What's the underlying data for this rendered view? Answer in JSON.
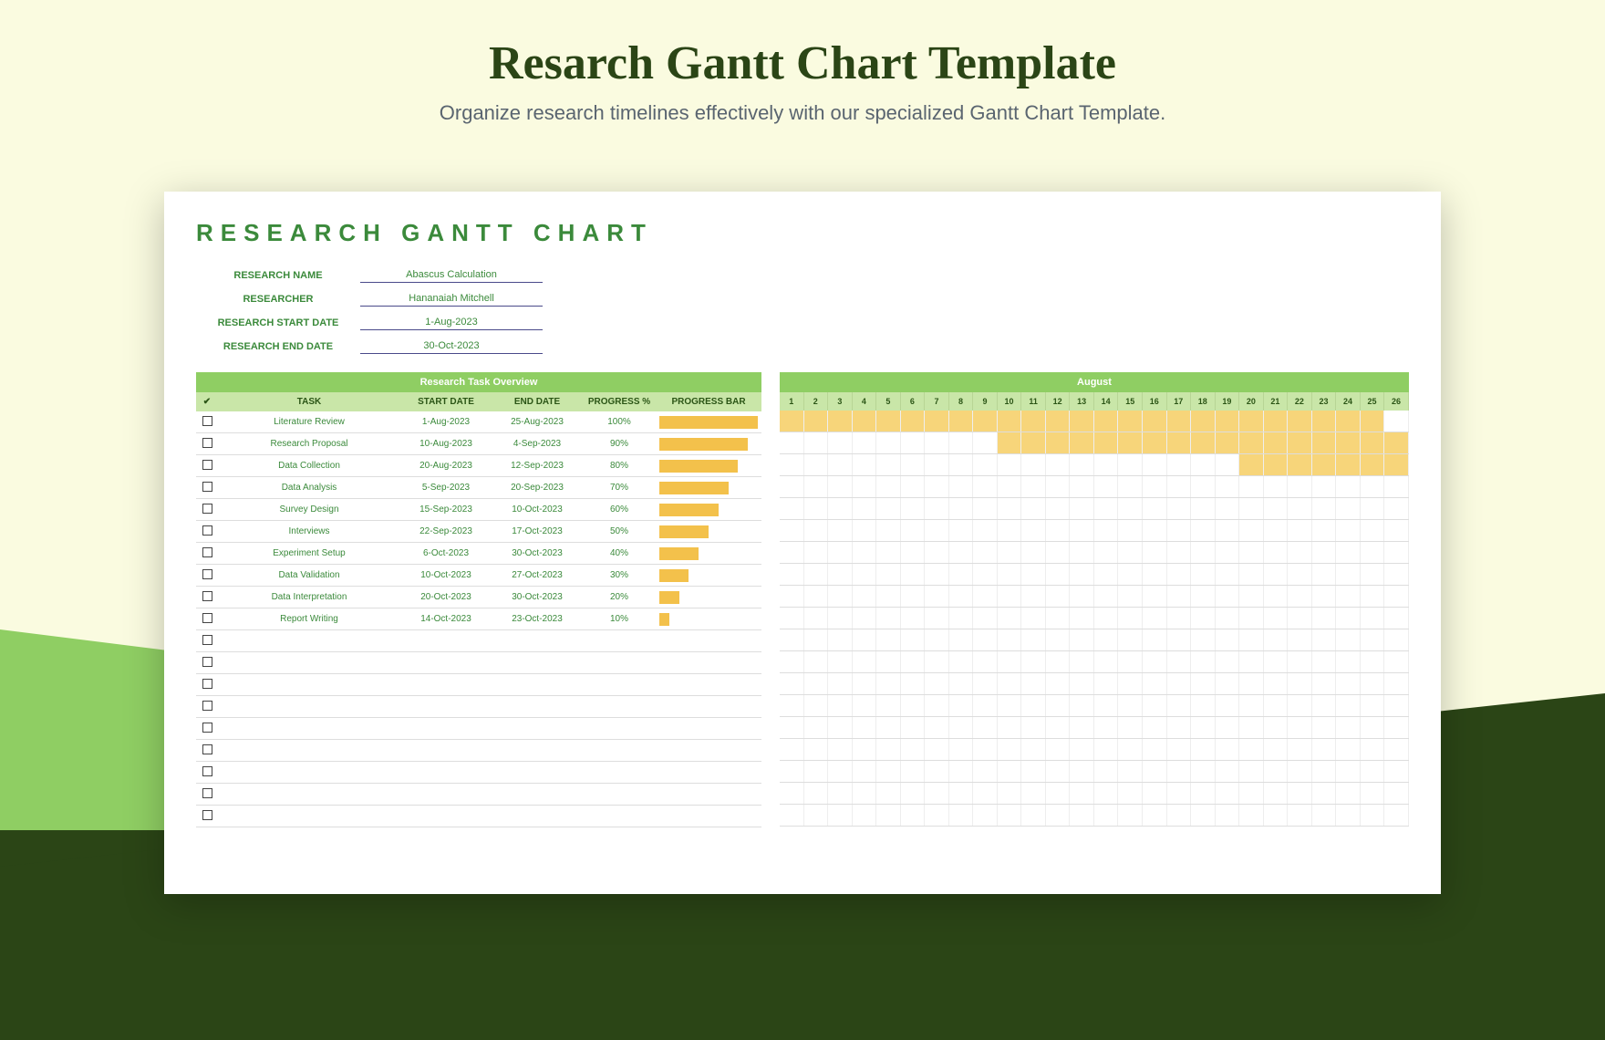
{
  "header": {
    "title": "Resarch Gantt Chart Template",
    "subtitle": "Organize research timelines effectively with our specialized Gantt Chart Template."
  },
  "sheet": {
    "title": "RESEARCH GANTT CHART",
    "meta": {
      "name_label": "RESEARCH NAME",
      "name_val": "Abascus Calculation",
      "researcher_label": "RESEARCHER",
      "researcher_val": "Hananaiah Mitchell",
      "start_label": "RESEARCH START DATE",
      "start_val": "1-Aug-2023",
      "end_label": "RESEARCH END DATE",
      "end_val": "30-Oct-2023"
    },
    "overview_title": "Research Task Overview",
    "cols": {
      "check": "✔",
      "task": "TASK",
      "start": "START DATE",
      "end": "END DATE",
      "prog": "PROGRESS %",
      "bar": "PROGRESS BAR"
    },
    "month": "August"
  },
  "chart_data": {
    "type": "gantt",
    "title": "Research Gantt Chart",
    "month_displayed": "August",
    "days": [
      1,
      2,
      3,
      4,
      5,
      6,
      7,
      8,
      9,
      10,
      11,
      12,
      13,
      14,
      15,
      16,
      17,
      18,
      19,
      20,
      21,
      22,
      23,
      24,
      25,
      26
    ],
    "tasks": [
      {
        "name": "Literature Review",
        "start": "1-Aug-2023",
        "end": "25-Aug-2023",
        "progress": 100,
        "aug_start": 1,
        "aug_end": 25
      },
      {
        "name": "Research Proposal",
        "start": "10-Aug-2023",
        "end": "4-Sep-2023",
        "progress": 90,
        "aug_start": 10,
        "aug_end": 26
      },
      {
        "name": "Data Collection",
        "start": "20-Aug-2023",
        "end": "12-Sep-2023",
        "progress": 80,
        "aug_start": 20,
        "aug_end": 26
      },
      {
        "name": "Data Analysis",
        "start": "5-Sep-2023",
        "end": "20-Sep-2023",
        "progress": 70,
        "aug_start": 0,
        "aug_end": 0
      },
      {
        "name": "Survey Design",
        "start": "15-Sep-2023",
        "end": "10-Oct-2023",
        "progress": 60,
        "aug_start": 0,
        "aug_end": 0
      },
      {
        "name": "Interviews",
        "start": "22-Sep-2023",
        "end": "17-Oct-2023",
        "progress": 50,
        "aug_start": 0,
        "aug_end": 0
      },
      {
        "name": "Experiment Setup",
        "start": "6-Oct-2023",
        "end": "30-Oct-2023",
        "progress": 40,
        "aug_start": 0,
        "aug_end": 0
      },
      {
        "name": "Data Validation",
        "start": "10-Oct-2023",
        "end": "27-Oct-2023",
        "progress": 30,
        "aug_start": 0,
        "aug_end": 0
      },
      {
        "name": "Data Interpretation",
        "start": "20-Oct-2023",
        "end": "30-Oct-2023",
        "progress": 20,
        "aug_start": 0,
        "aug_end": 0
      },
      {
        "name": "Report Writing",
        "start": "14-Oct-2023",
        "end": "23-Oct-2023",
        "progress": 10,
        "aug_start": 0,
        "aug_end": 0
      }
    ],
    "empty_rows": 9
  }
}
